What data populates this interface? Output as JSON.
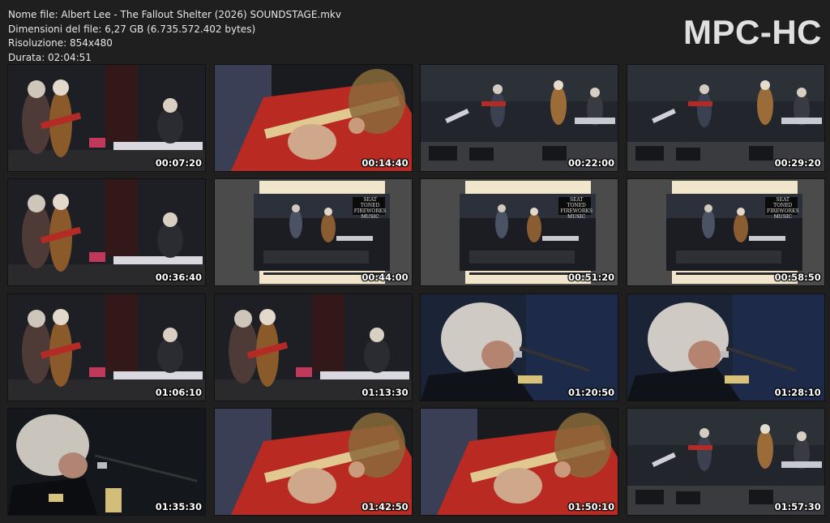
{
  "file_info": {
    "name": "Nome file: Albert Lee - The Fallout Shelter (2026) SOUNDSTAGE.mkv",
    "size": "Dimensioni del file: 6,27 GB (6.735.572.402 bytes)",
    "resolution": "Risoluzione: 854x480",
    "duration": "Durata: 02:04:51"
  },
  "logo": "MPC-HC",
  "thumbnails": [
    {
      "time": "00:07:20",
      "scene": "stage"
    },
    {
      "time": "00:14:40",
      "scene": "close"
    },
    {
      "time": "00:22:00",
      "scene": "wide"
    },
    {
      "time": "00:29:20",
      "scene": "wide"
    },
    {
      "time": "00:36:40",
      "scene": "stage"
    },
    {
      "time": "00:44:00",
      "scene": "frame"
    },
    {
      "time": "00:51:20",
      "scene": "frame"
    },
    {
      "time": "00:58:50",
      "scene": "frame"
    },
    {
      "time": "01:06:10",
      "scene": "stage"
    },
    {
      "time": "01:13:30",
      "scene": "stage"
    },
    {
      "time": "01:20:50",
      "scene": "bluecu"
    },
    {
      "time": "01:28:10",
      "scene": "bluecu"
    },
    {
      "time": "01:35:30",
      "scene": "dark"
    },
    {
      "time": "01:42:50",
      "scene": "close"
    },
    {
      "time": "01:50:10",
      "scene": "close"
    },
    {
      "time": "01:57:30",
      "scene": "wide"
    }
  ],
  "overlay_text": {
    "frame_logo": "SEAT TONED FIREWORKS MUSIC"
  }
}
